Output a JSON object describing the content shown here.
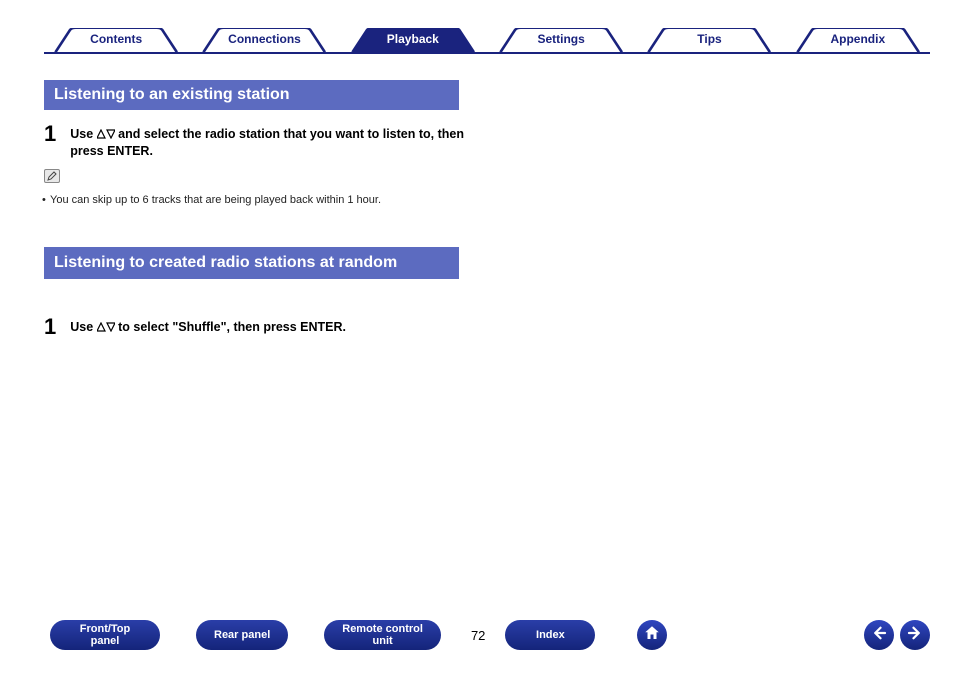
{
  "tabs": {
    "contents": "Contents",
    "connections": "Connections",
    "playback": "Playback",
    "settings": "Settings",
    "tips": "Tips",
    "appendix": "Appendix",
    "active_index": 2
  },
  "section1": {
    "heading": "Listening to an existing station",
    "step_num": "1",
    "step_before": "Use ",
    "step_after": " and select the radio station that you want to listen to, then press ENTER.",
    "note": "You can skip up to 6 tracks that are being played back within 1 hour."
  },
  "section2": {
    "heading": "Listening to created radio stations at random",
    "step_num": "1",
    "step_before": "Use ",
    "step_after": " to select \"Shuffle\", then press ENTER."
  },
  "bottom_nav": {
    "front_top_panel_l1": "Front/Top",
    "front_top_panel_l2": "panel",
    "rear_panel": "Rear panel",
    "remote_l1": "Remote control",
    "remote_l2": "unit",
    "index": "Index"
  },
  "page_number": "72",
  "colors": {
    "brand": "#1a237e",
    "heading": "#5c6bc0"
  }
}
